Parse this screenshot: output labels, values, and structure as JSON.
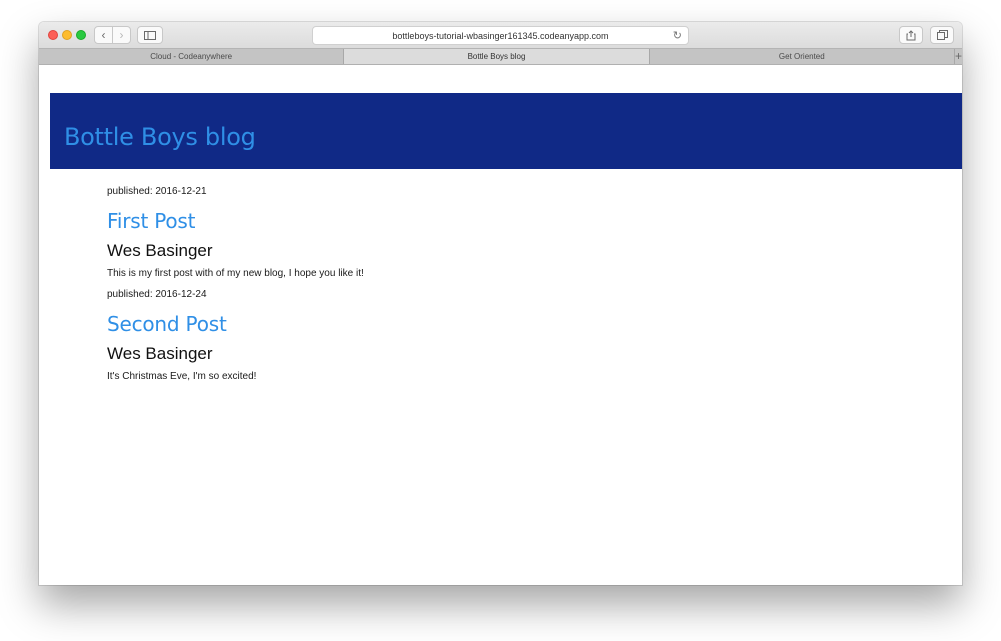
{
  "browser": {
    "url": "bottleboys-tutorial-wbasinger161345.codeanyapp.com",
    "tabs": [
      {
        "label": "Cloud - Codeanywhere",
        "active": false
      },
      {
        "label": "Bottle Boys blog",
        "active": true
      },
      {
        "label": "Get Oriented",
        "active": false
      }
    ],
    "new_tab_label": "+"
  },
  "site": {
    "title": "Bottle Boys blog",
    "header_color": "#102986",
    "accent_color": "#2f8fe6"
  },
  "posts": [
    {
      "published": "published: 2016-12-21",
      "title": "First Post",
      "author": "Wes Basinger",
      "body": "This is my first post with of my new blog, I hope you like it!"
    },
    {
      "published": "published: 2016-12-24",
      "title": "Second Post",
      "author": "Wes Basinger",
      "body": "It's Christmas Eve, I'm so excited!"
    }
  ]
}
